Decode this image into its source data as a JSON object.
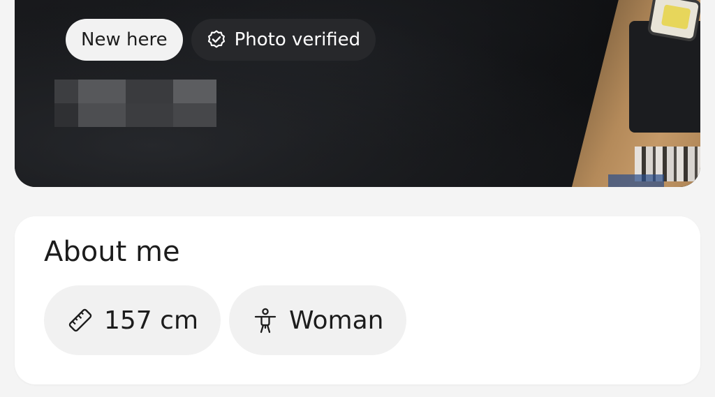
{
  "profile": {
    "badges": {
      "new": "New here",
      "verified": "Photo verified"
    },
    "name_obscured": true
  },
  "about": {
    "title": "About me",
    "chips": [
      {
        "icon": "ruler-icon",
        "label": "157 cm"
      },
      {
        "icon": "person-icon",
        "label": "Woman"
      }
    ]
  },
  "colors": {
    "page_bg": "#f4f4f4",
    "card_bg": "#ffffff",
    "chip_bg": "#f1f1f1",
    "badge_light": "#f2f2f2",
    "badge_dark": "#28292c",
    "text": "#1c1c1c"
  }
}
